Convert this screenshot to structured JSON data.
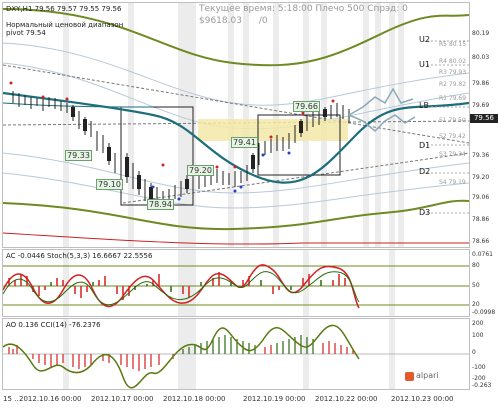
{
  "chart_header": {
    "symbol_line": "DXY,H1  79.56 79.57 79.55 79.56",
    "server_time": "Текущее время: 5:18:00 Плечо 500 Спрэд: 0",
    "balance": "$9618.03",
    "balance_suffix": "/0",
    "indicator_name": "Нормальный ценовой диапазон",
    "indicator_value": "pivot 79.54"
  },
  "price_axis": {
    "levels": [
      "U2",
      "U1",
      "LB",
      "D1",
      "D2",
      "D3"
    ],
    "right_labels": [
      "R5 80.15",
      "R4 80.02",
      "R3 79.93",
      "R2 79.82",
      "R1 79.69",
      "S1 79.50",
      "S2 79.42",
      "S3 79.34",
      "S4 79.19"
    ],
    "ticks": [
      "80.19",
      "80.03",
      "79.86",
      "79.69",
      "79.56",
      "79.36",
      "79.20",
      "79.06",
      "78.86",
      "78.66"
    ],
    "current_price": "79.56"
  },
  "annotations": [
    "79.66",
    "79.41",
    "79.33",
    "79.20",
    "79.10",
    "78.94"
  ],
  "ac_panel": {
    "header": "AC -0.0446  Stoch(5,3,3) 16.6667 22.5556",
    "ticks": [
      "0.0761",
      "-0.0998"
    ],
    "levels": [
      "80",
      "50",
      "20"
    ]
  },
  "ao_panel": {
    "header": "AO 0.136  CCI(14) -76.2376",
    "ticks": [
      "200",
      "100",
      "0",
      "-100",
      "-200",
      "-0.263"
    ]
  },
  "time_axis": [
    "15 ..",
    "2012.10.16 00:00",
    "2012.10.17 00:00",
    "2012.10.18 00:00",
    "2012.10.19 00:00",
    "2012.10.22 00:00",
    "2012.10.23 00:00"
  ],
  "branding": {
    "logo_text": "alpari"
  },
  "colors": {
    "buy_dot": "#d42020",
    "sell_dot": "#2040d0",
    "ma_teal": "#1b6e7a",
    "ma_olive": "#5a7a10",
    "box_yellow": "#f3e9a8",
    "stoch_red": "#d42020"
  }
}
